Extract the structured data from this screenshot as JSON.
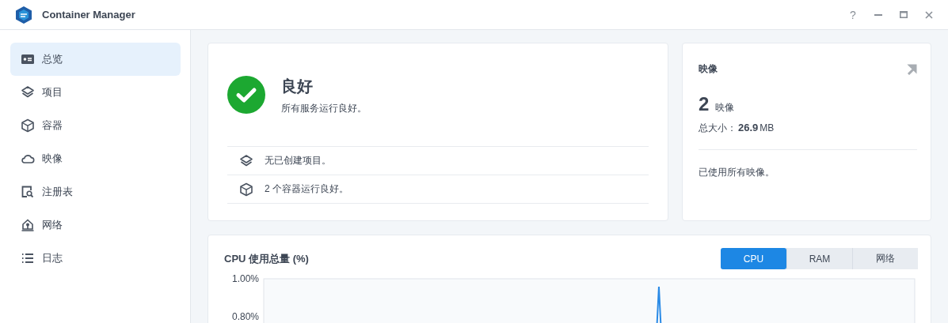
{
  "window": {
    "title": "Container Manager",
    "help": "?"
  },
  "sidebar": {
    "items": [
      {
        "label": "总览",
        "kind": "overview",
        "selected": true
      },
      {
        "label": "项目",
        "kind": "layers",
        "selected": false
      },
      {
        "label": "容器",
        "kind": "cube",
        "selected": false
      },
      {
        "label": "映像",
        "kind": "cloud",
        "selected": false
      },
      {
        "label": "注册表",
        "kind": "registry",
        "selected": false
      },
      {
        "label": "网络",
        "kind": "network",
        "selected": false
      },
      {
        "label": "日志",
        "kind": "list",
        "selected": false
      }
    ]
  },
  "status_card": {
    "title": "良好",
    "message": "所有服务运行良好。",
    "rows": [
      {
        "kind": "layers",
        "text": "无已创建项目。"
      },
      {
        "kind": "cube",
        "text": "2 个容器运行良好。"
      }
    ]
  },
  "image_card": {
    "title": "映像",
    "count": "2",
    "count_unit": "映像",
    "size_label": "总大小：",
    "size_value": "26.9",
    "size_unit": "MB",
    "note": "已使用所有映像。"
  },
  "usage_card": {
    "title": "CPU 使用总量 (%)",
    "tabs": [
      {
        "label": "CPU",
        "selected": true
      },
      {
        "label": "RAM",
        "selected": false
      },
      {
        "label": "网络",
        "selected": false
      }
    ],
    "axis_labels": [
      "1.00%",
      "0.80%"
    ]
  }
}
